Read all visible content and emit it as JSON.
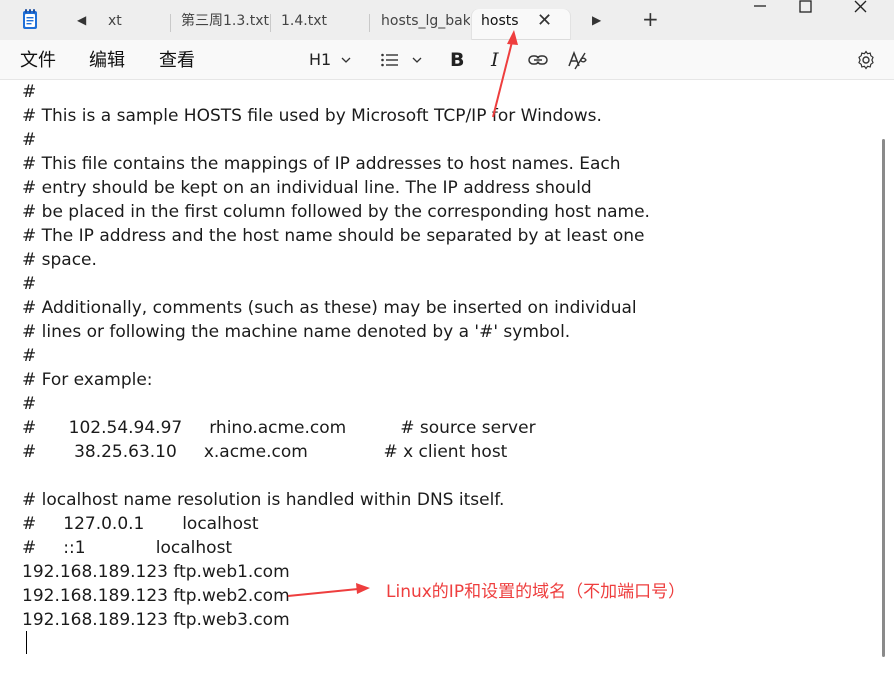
{
  "tabs": {
    "items": [
      {
        "label": "xt"
      },
      {
        "label": "第三周1.3.txt"
      },
      {
        "label": "1.4.txt"
      },
      {
        "label": "hosts_lg_bak"
      },
      {
        "label": "hosts"
      }
    ],
    "active_index": 4,
    "new_tab_label": "+",
    "close_label": "✕"
  },
  "menu": {
    "file": "文件",
    "edit": "编辑",
    "view": "查看"
  },
  "toolbar": {
    "heading": "H1",
    "bold": "B",
    "italic": "I"
  },
  "editor": {
    "lines": [
      "#",
      "# This is a sample HOSTS file used by Microsoft TCP/IP for Windows.",
      "#",
      "# This file contains the mappings of IP addresses to host names. Each",
      "# entry should be kept on an individual line. The IP address should",
      "# be placed in the first column followed by the corresponding host name.",
      "# The IP address and the host name should be separated by at least one",
      "# space.",
      "#",
      "# Additionally, comments (such as these) may be inserted on individual",
      "# lines or following the machine name denoted by a '#' symbol.",
      "#",
      "# For example:",
      "#",
      "#      102.54.94.97     rhino.acme.com          # source server",
      "#       38.25.63.10     x.acme.com              # x client host",
      "",
      "# localhost name resolution is handled within DNS itself.",
      "#     127.0.0.1       localhost",
      "#     ::1             localhost",
      "192.168.189.123 ftp.web1.com",
      "192.168.189.123 ftp.web2.com",
      "192.168.189.123 ftp.web3.com"
    ]
  },
  "annotation": {
    "text": "Linux的IP和设置的域名（不加端口号）",
    "color": "#ee3e3e"
  },
  "colors": {
    "tabbar_bg": "#eeeeee",
    "toolbar_bg": "#f9f9f9",
    "editor_bg": "#ffffff"
  }
}
